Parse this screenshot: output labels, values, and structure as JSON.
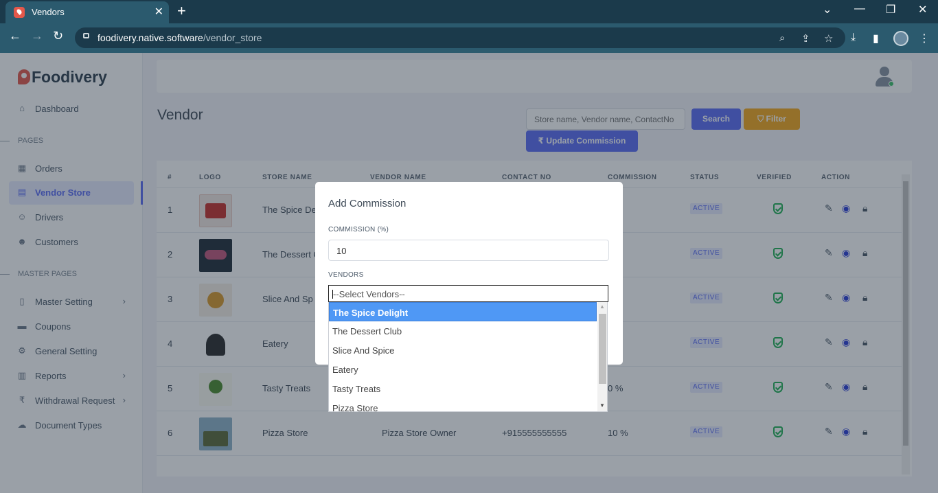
{
  "browser": {
    "tab_title": "Vendors",
    "url_host": "foodivery.native.software",
    "url_path": "/vendor_store"
  },
  "sidebar": {
    "brand": "Foodivery",
    "items": [
      {
        "label": "Dashboard",
        "icon": "home-icon"
      },
      {
        "label": "Orders",
        "icon": "grid-icon"
      },
      {
        "label": "Vendor Store",
        "icon": "store-icon"
      },
      {
        "label": "Drivers",
        "icon": "user-icon"
      },
      {
        "label": "Customers",
        "icon": "users-icon"
      },
      {
        "label": "Master Setting",
        "icon": "book-icon"
      },
      {
        "label": "Coupons",
        "icon": "ticket-icon"
      },
      {
        "label": "General Setting",
        "icon": "gear-icon"
      },
      {
        "label": "Reports",
        "icon": "report-icon"
      },
      {
        "label": "Withdrawal Request",
        "icon": "rupee-icon"
      },
      {
        "label": "Document Types",
        "icon": "cloud-icon"
      }
    ],
    "sections": [
      "PAGES",
      "MASTER PAGES"
    ]
  },
  "page": {
    "title": "Vendor",
    "search_placeholder": "Store name, Vendor name, ContactNo",
    "search_button": "Search",
    "filter_button": "Filter",
    "update_button": "Update Commission"
  },
  "table": {
    "headers": [
      "#",
      "LOGO",
      "STORE NAME",
      "VENDOR NAME",
      "CONTACT NO",
      "COMMISSION",
      "STATUS",
      "VERIFIED",
      "ACTION"
    ],
    "rows": [
      {
        "num": "1",
        "store": "The Spice De",
        "vendor": "",
        "contact": "",
        "commission": "",
        "status": "ACTIVE"
      },
      {
        "num": "2",
        "store": "The Dessert C",
        "vendor": "",
        "contact": "",
        "commission": "",
        "status": "ACTIVE"
      },
      {
        "num": "3",
        "store": "Slice And Sp",
        "vendor": "",
        "contact": "",
        "commission": "",
        "status": "ACTIVE"
      },
      {
        "num": "4",
        "store": "Eatery",
        "vendor": "",
        "contact": "",
        "commission": "",
        "status": "ACTIVE"
      },
      {
        "num": "5",
        "store": "Tasty Treats",
        "vendor": "",
        "contact": "",
        "commission": "0 %",
        "status": "ACTIVE"
      },
      {
        "num": "6",
        "store": "Pizza Store",
        "vendor": "Pizza Store Owner",
        "contact": "+915555555555",
        "commission": "10 %",
        "status": "ACTIVE"
      }
    ]
  },
  "modal": {
    "title": "Add Commission",
    "commission_label": "COMMISSION (%)",
    "commission_value": "10",
    "vendors_label": "VENDORS",
    "vendors_placeholder": "--Select Vendors--",
    "options": [
      "The Spice Delight",
      "The Dessert Club",
      "Slice And Spice",
      "Eatery",
      "Tasty Treats",
      "Pizza Store"
    ],
    "highlighted_option": "The Spice Delight"
  },
  "colors": {
    "primary": "#5b6cf5",
    "warning": "#f4a81d",
    "success": "#1fb155",
    "highlight": "#4f98f5"
  }
}
